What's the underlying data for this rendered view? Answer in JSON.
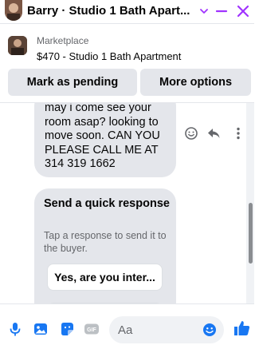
{
  "header": {
    "title": "Barry · Studio 1 Bath Apart...",
    "icons": [
      "avatar",
      "chevron-down-icon",
      "minimize-icon",
      "close-icon"
    ]
  },
  "marketplace": {
    "label": "Marketplace",
    "item": "$470 - Studio 1 Bath Apartment"
  },
  "actions": {
    "mark_pending": "Mark as pending",
    "more_options": "More options"
  },
  "message": {
    "lines": [
      "may i come see your",
      "room asap? looking to",
      "move soon. CAN YOU",
      "PLEASE CALL ME AT",
      "314 319 1662"
    ]
  },
  "quick_response": {
    "title": "Send a quick response",
    "subtitle": "Tap a response to send it to the buyer.",
    "options": [
      "Yes, are you inter..."
    ]
  },
  "composer": {
    "placeholder": "Aa",
    "icons": [
      "microphone-icon",
      "photo-icon",
      "sticker-icon",
      "gif-icon",
      "emoji-icon",
      "like-icon"
    ]
  },
  "colors": {
    "accent": "#1877f2",
    "purple": "#a033ff",
    "bubble": "#e4e6eb"
  }
}
